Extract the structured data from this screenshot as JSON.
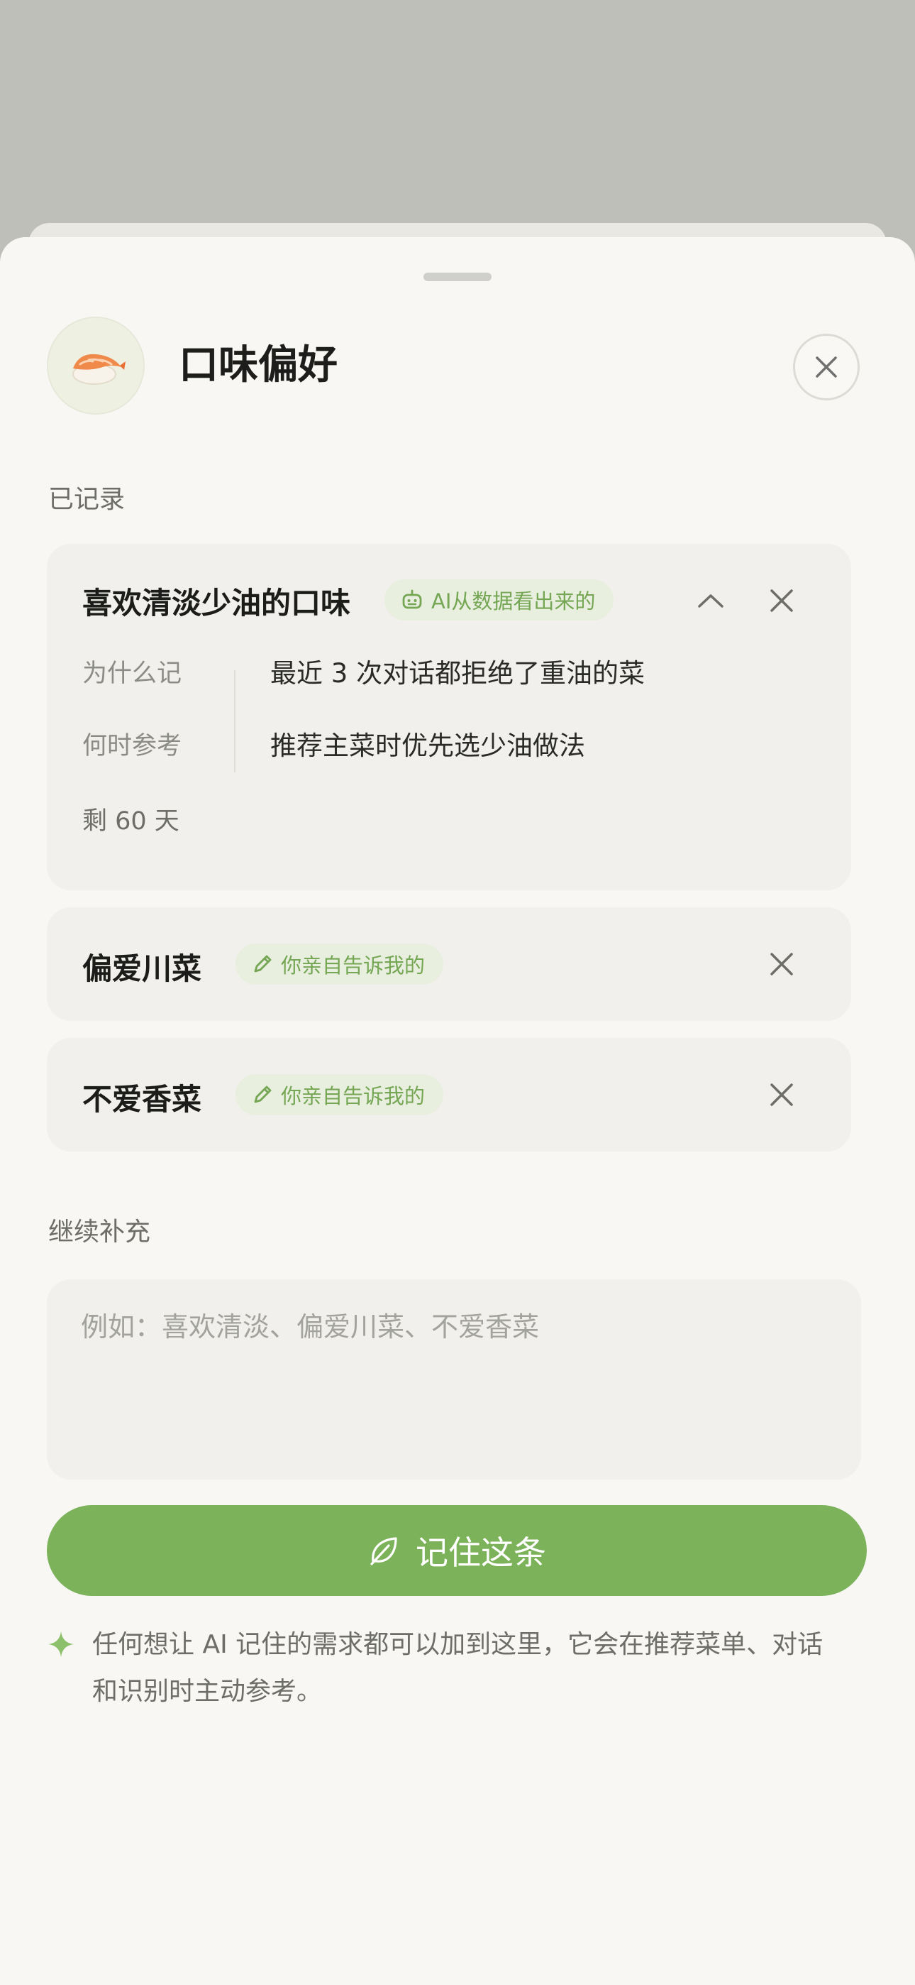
{
  "sheet": {
    "title": "口味偏好",
    "avatar_icon": "sushi-icon",
    "close_icon": "close-icon"
  },
  "recorded": {
    "section_label": "已记录",
    "items": [
      {
        "title": "喜欢清淡少油的口味",
        "badge": "AI从数据看出来的",
        "badge_icon": "robot-icon",
        "expanded": true,
        "why_label": "为什么记",
        "why_value": "最近 3 次对话都拒绝了重油的菜",
        "when_label": "何时参考",
        "when_value": "推荐主菜时优先选少油做法",
        "remaining": "剩 60 天"
      },
      {
        "title": "偏爱川菜",
        "badge": "你亲自告诉我的",
        "badge_icon": "pencil-icon",
        "expanded": false
      },
      {
        "title": "不爱香菜",
        "badge": "你亲自告诉我的",
        "badge_icon": "pencil-icon",
        "expanded": false
      }
    ]
  },
  "add": {
    "section_label": "继续补充",
    "placeholder": "例如：喜欢清淡、偏爱川菜、不爱香菜",
    "value": "",
    "submit_label": "记住这条",
    "submit_icon": "leaf-icon"
  },
  "hint": {
    "icon": "sparkle-icon",
    "text": "任何想让 AI 记住的需求都可以加到这里，它会在推荐菜单、对话和识别时主动参考。"
  },
  "colors": {
    "accent": "#7cb35a",
    "badge_bg": "#e8efdf",
    "badge_text": "#74a653",
    "card_bg": "#f1f0ec",
    "sheet_bg": "#f8f7f4",
    "backdrop": "#bfbfba"
  }
}
